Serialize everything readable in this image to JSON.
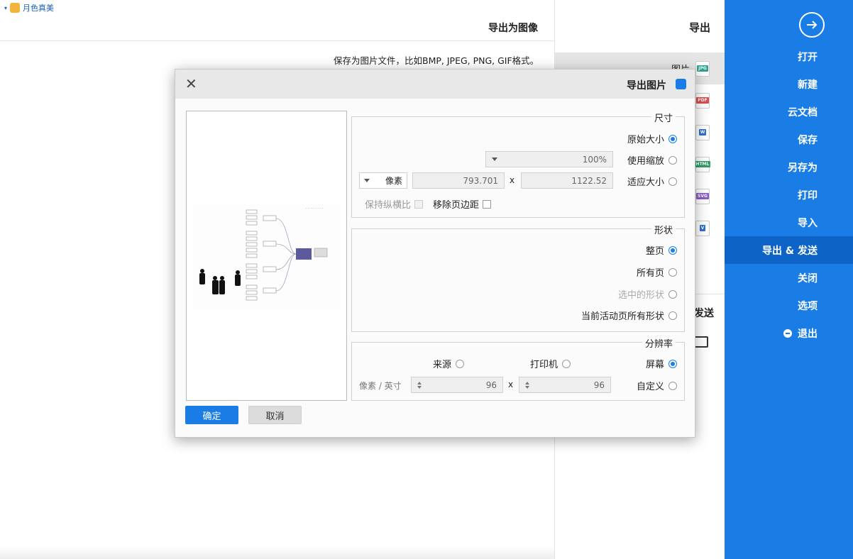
{
  "brand": {
    "label": "月色真美"
  },
  "content": {
    "title": "导出为图像",
    "description": "保存为图片文件，比如BMP, JPEG, PNG, GIF格式。"
  },
  "sidebar": {
    "items": [
      {
        "label": "打开"
      },
      {
        "label": "新建"
      },
      {
        "label": "云文档"
      },
      {
        "label": "保存"
      },
      {
        "label": "另存为"
      },
      {
        "label": "打印"
      },
      {
        "label": "导入"
      },
      {
        "label": "导出 & 发送",
        "active": true
      },
      {
        "label": "关闭"
      },
      {
        "label": "选项"
      },
      {
        "label": "退出"
      }
    ]
  },
  "export_panel": {
    "title": "导出",
    "formats": [
      {
        "label": "图片",
        "icon_text": "JPG",
        "icon_color": "#2fa58f",
        "active": true
      },
      {
        "label": "",
        "icon_text": "PDF",
        "icon_color": "#e04c4c"
      },
      {
        "label": "",
        "icon_text": "W",
        "icon_color": "#2f6fcf"
      },
      {
        "label": "",
        "icon_text": "HTML",
        "icon_color": "#2f9e68"
      },
      {
        "label": "",
        "icon_text": "SVG",
        "icon_color": "#8a5ec5"
      },
      {
        "label": "",
        "icon_text": "V",
        "icon_color": "#2f6fcf"
      }
    ],
    "send_label": "发送"
  },
  "dialog": {
    "title": "导出图片",
    "size": {
      "legend": "尺寸",
      "original": "原始大小",
      "scale": "使用缩放",
      "scale_value": "100%",
      "fit": "适应大小",
      "width": "1122.52",
      "x": "x",
      "height": "793.701",
      "unit": "像素",
      "remove_margin": "移除页边距",
      "keep_ratio": "保持纵横比"
    },
    "shape": {
      "legend": "形状",
      "whole_page": "整页",
      "all_pages": "所有页",
      "selected": "选中的形状",
      "current_page": "当前活动页所有形状"
    },
    "resolution": {
      "legend": "分辨率",
      "screen": "屏幕",
      "printer": "打印机",
      "source": "来源",
      "custom": "自定义",
      "dpi_x": "96",
      "x": "x",
      "dpi_y": "96",
      "unit": "像素 / 英寸"
    },
    "ok": "确定",
    "cancel": "取消"
  }
}
